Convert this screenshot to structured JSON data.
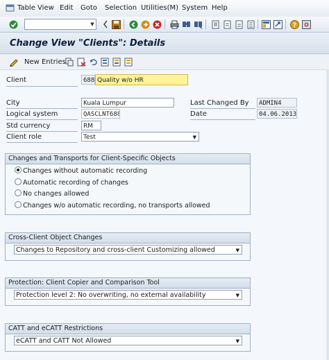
{
  "menu": {
    "items": [
      "Table View",
      "Edit",
      "Goto",
      "Selection",
      "Utilities(M)",
      "System",
      "Help"
    ]
  },
  "toolbar": {
    "icons": [
      "enter-icon",
      "back-icon",
      "save-icon",
      "exit-icon",
      "cancel-icon",
      "print-icon",
      "find-icon",
      "find-next-icon",
      "first-page-icon",
      "previous-page-icon",
      "next-page-icon",
      "last-page-icon",
      "create-session-icon",
      "shortcut-icon",
      "help-icon",
      "customize-layout-icon"
    ]
  },
  "title": "Change View \"Clients\": Details",
  "app_toolbar": {
    "new_entries": "New Entries"
  },
  "form": {
    "client_label": "Client",
    "client_number": "688",
    "client_name": "Quality w/o HR",
    "city_label": "City",
    "city": "Kuala Lumpur",
    "logical_system_label": "Logical system",
    "logical_system": "QASCLNT688",
    "currency_label": "Std currency",
    "currency": "RM",
    "role_label": "Client role",
    "role": "Test",
    "last_changed_label": "Last Changed By",
    "last_changed": "ADMIN4",
    "date_label": "Date",
    "date": "04.06.2013"
  },
  "groups": {
    "transports": {
      "title": "Changes and Transports for Client-Specific Objects",
      "options": [
        "Changes without automatic recording",
        "Automatic recording of changes",
        "No changes allowed",
        "Changes w/o automatic recording, no transports allowed"
      ],
      "selected": 0
    },
    "cross_client": {
      "title": "Cross-Client Object Changes",
      "value": "Changes to Repository and cross-client Customizing allowed"
    },
    "protection": {
      "title": "Protection: Client Copier and Comparison Tool",
      "value": "Protection level 2: No overwriting, no external availability"
    },
    "catt": {
      "title": "CATT and eCATT Restrictions",
      "value": "eCATT and CATT Not Allowed"
    }
  },
  "colors": {
    "highlight_field": "#fff39b",
    "title_text": "#0b1f3a"
  }
}
